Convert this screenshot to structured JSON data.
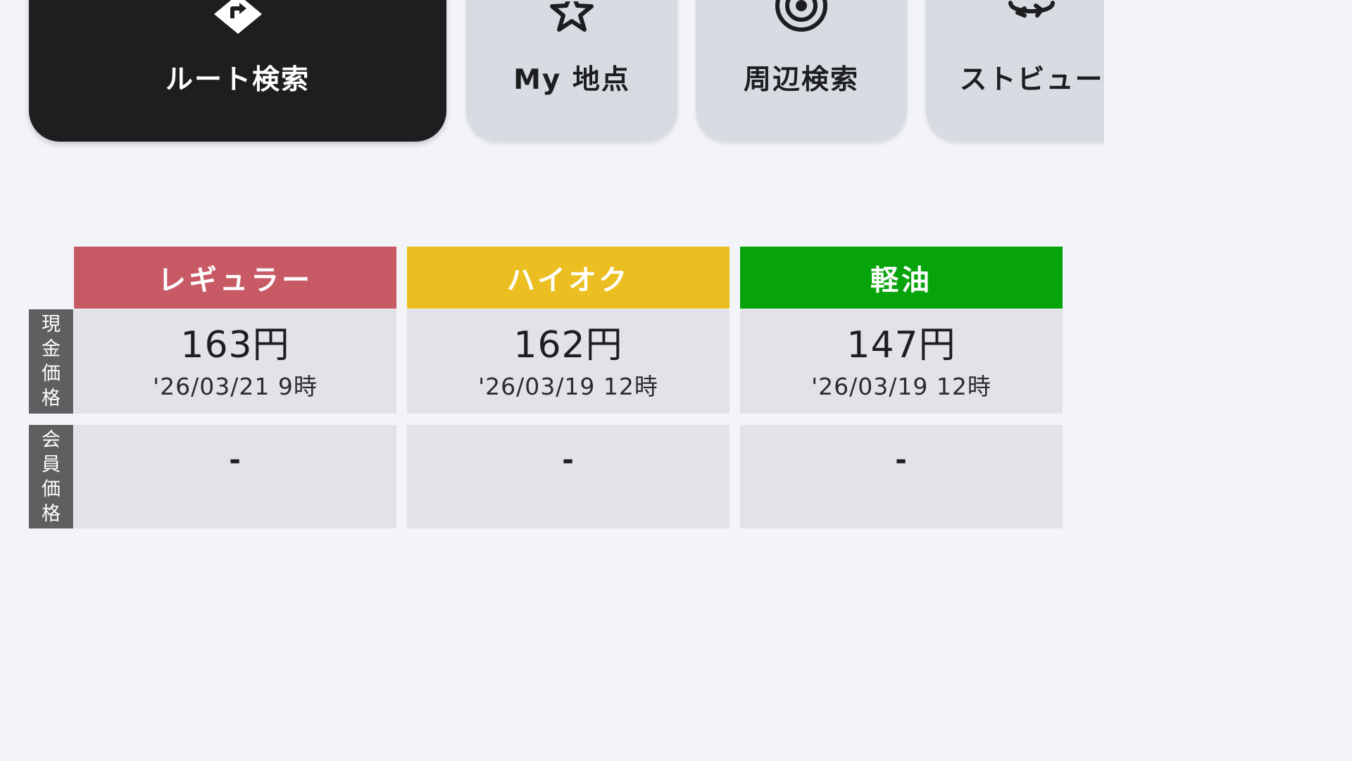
{
  "actions": [
    {
      "label": "ルート検索",
      "icon": "route-diamond-icon"
    },
    {
      "label": "My 地点",
      "icon": "star-icon"
    },
    {
      "label": "周辺検索",
      "icon": "nearby-target-icon"
    },
    {
      "label": "ストビュー",
      "icon": "street-view-rotate-icon"
    }
  ],
  "fuel_table": {
    "headers": [
      {
        "label": "レギュラー",
        "color": "#c85a66"
      },
      {
        "label": "ハイオク",
        "color": "#ebbf22"
      },
      {
        "label": "軽油",
        "color": "#07a30b"
      }
    ],
    "rows": [
      {
        "label": [
          "現",
          "金",
          "価",
          "格"
        ],
        "cells": [
          {
            "price": "163円",
            "date": "'26/03/21 9時"
          },
          {
            "price": "162円",
            "date": "'26/03/19 12時"
          },
          {
            "price": "147円",
            "date": "'26/03/19 12時"
          }
        ]
      },
      {
        "label": [
          "会",
          "員",
          "価",
          "格"
        ],
        "cells": [
          {
            "price": "-"
          },
          {
            "price": "-"
          },
          {
            "price": "-"
          }
        ]
      }
    ]
  },
  "colors": {
    "background": "#f3f4f8",
    "primary_button": "#1d1e20",
    "secondary_button": "#d8dce2",
    "cell": "#e2e3e9",
    "row_label": "#5f5f61"
  }
}
